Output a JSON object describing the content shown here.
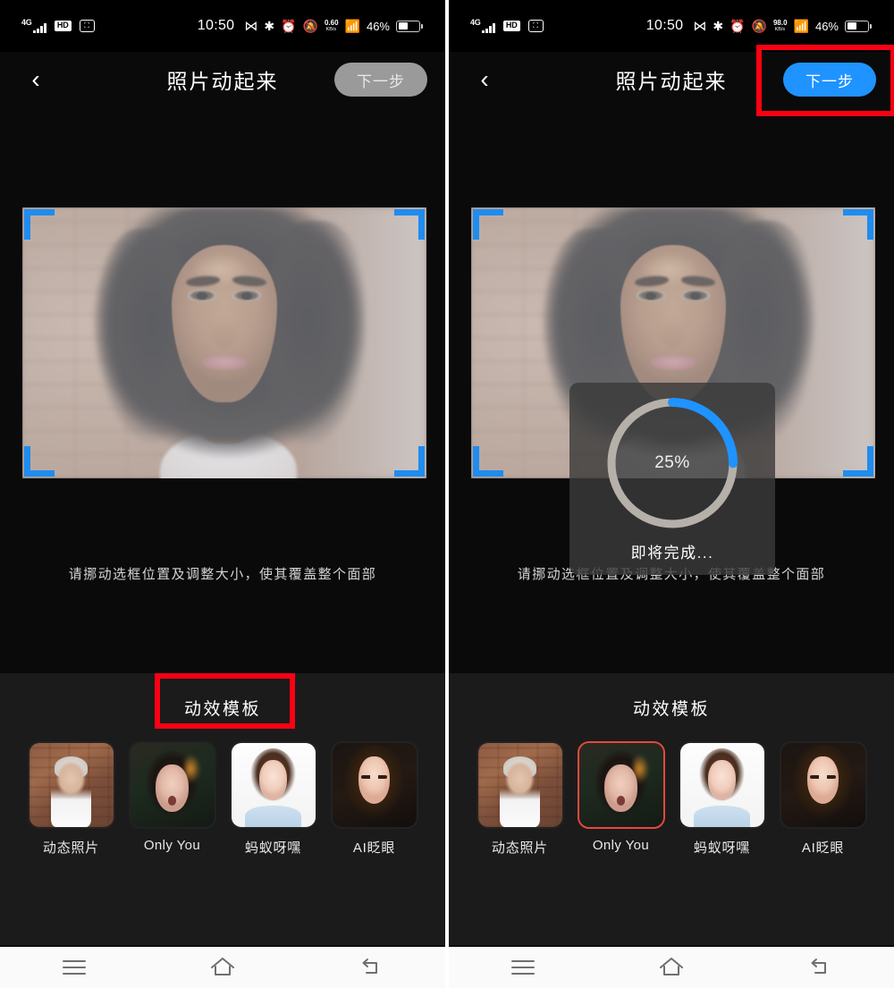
{
  "app": {
    "title": "照片动起来",
    "hint": "请挪动选框位置及调整大小，使其覆盖整个面部",
    "template_section_title": "动效模板",
    "back_icon": "‹"
  },
  "status_bar": {
    "left": {
      "network_type": "4G",
      "hd_badge": "HD",
      "cast_icon": "screen-cast-icon"
    },
    "clock": "10:50",
    "icons": [
      "nfc-icon",
      "bluetooth-icon",
      "alarm-icon",
      "mute-bell-icon",
      "wifi-icon"
    ],
    "net_speed_left": {
      "value": "0.60",
      "unit": "KB/s"
    },
    "net_speed_right": {
      "value": "98.0",
      "unit": "KB/s"
    },
    "battery_percent": "46%",
    "battery_level": 46
  },
  "panels": {
    "left": {
      "next_button": {
        "label": "下一步",
        "state": "disabled"
      },
      "selected_template_index": -1,
      "progress_visible": false,
      "annotation": "template-section-title"
    },
    "right": {
      "next_button": {
        "label": "下一步",
        "state": "active"
      },
      "selected_template_index": 1,
      "progress_visible": true,
      "annotation": "next-button"
    }
  },
  "progress": {
    "percent_label": "25%",
    "percent_value": 25,
    "status_label": "即将完成...",
    "track_color": "#b5b0a9",
    "fill_color": "#1f93ff"
  },
  "templates": [
    {
      "label": "动态照片",
      "art": "t1",
      "latin": false
    },
    {
      "label": "Only You",
      "art": "t2",
      "latin": true
    },
    {
      "label": "蚂蚁呀嘿",
      "art": "t3",
      "latin": false
    },
    {
      "label": "AI眨眼",
      "art": "t4",
      "latin": false
    }
  ],
  "nav_bar": {
    "items": [
      "menu-icon",
      "home-icon",
      "back-icon"
    ]
  },
  "colors": {
    "accent_blue": "#1f93ff",
    "crop_corner_blue": "#1f8cf0",
    "annotation_red": "#fc0013",
    "selection_red": "#e8483c",
    "panel_bg": "#0a0a0a",
    "tray_bg": "#1b1b1b"
  }
}
